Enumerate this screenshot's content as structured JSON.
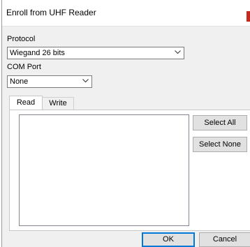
{
  "window": {
    "title": "Enroll from UHF Reader"
  },
  "protocol": {
    "label": "Protocol",
    "selected": "Wiegand 26 bits"
  },
  "com_port": {
    "label": "COM Port",
    "selected": "None"
  },
  "tabs": [
    {
      "label": "Read",
      "active": true
    },
    {
      "label": "Write",
      "active": false
    }
  ],
  "read_panel": {
    "select_all_label": "Select All",
    "select_none_label": "Select None"
  },
  "footer": {
    "ok_label": "OK",
    "cancel_label": "Cancel"
  },
  "colors": {
    "accent": "#0078d7",
    "close": "#c42b1c"
  }
}
